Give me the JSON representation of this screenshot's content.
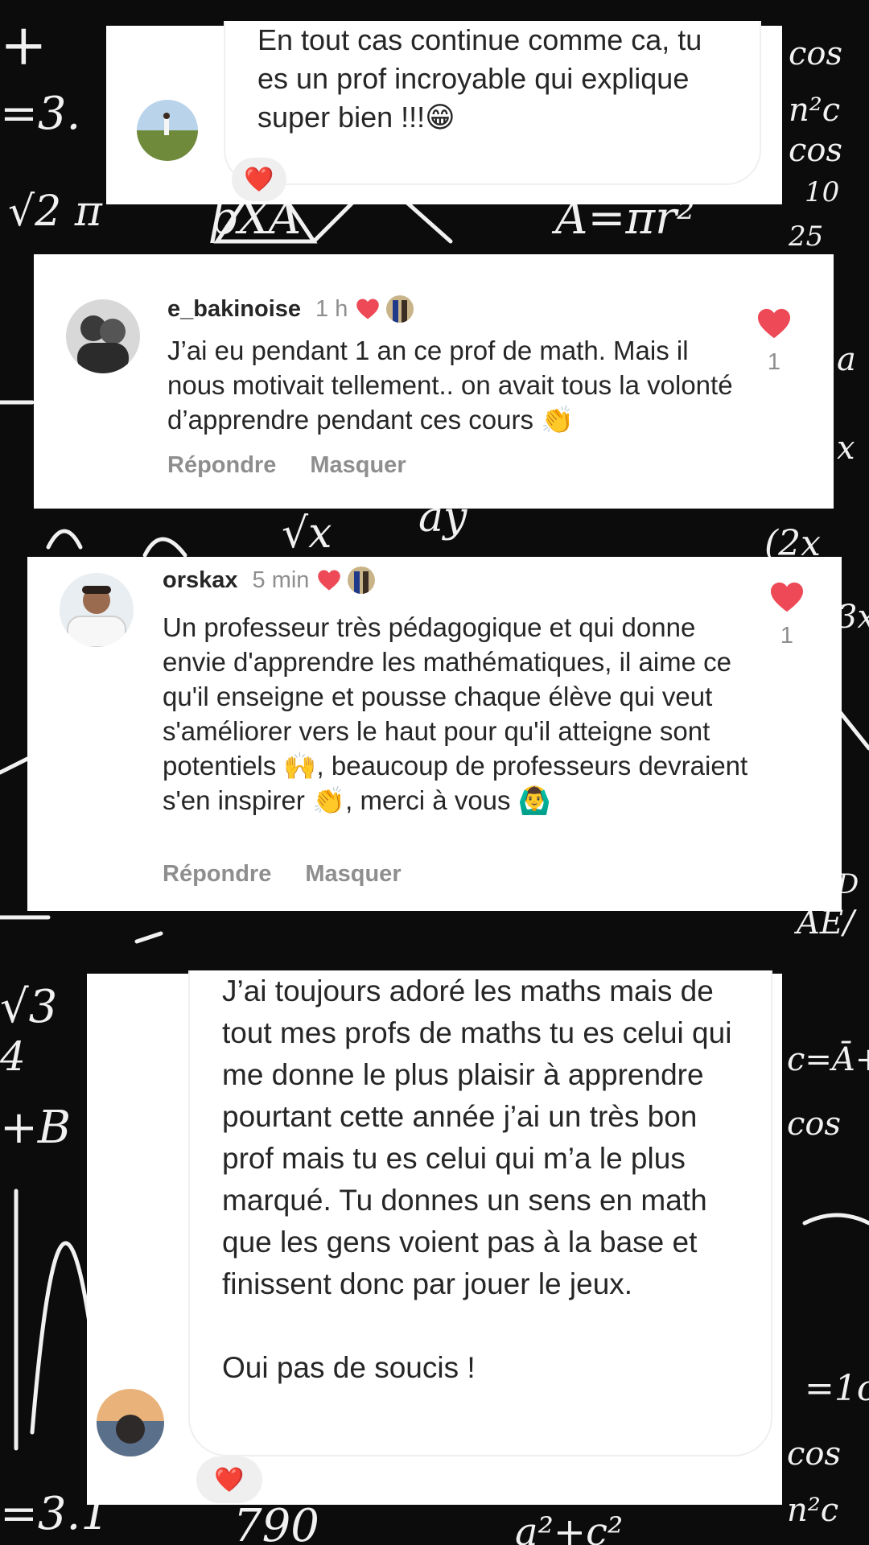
{
  "message_top": {
    "text": "En tout cas continue comme ca, tu es un prof incroyable qui explique super bien !!!😁",
    "reaction": "❤️"
  },
  "comments": [
    {
      "username": "e_bakinoise",
      "time": "1 h",
      "text": "J’ai eu pendant 1 an ce prof de math. Mais il nous motivait tellement.. on avait tous la volonté d’apprendre pendant ces cours 👏",
      "reply_label": "Répondre",
      "hide_label": "Masquer",
      "like_count": "1"
    },
    {
      "username": "orskax",
      "time": "5 min",
      "text": "Un professeur très pédagogique et qui donne envie d'apprendre les mathématiques, il aime ce qu'il enseigne et pousse chaque élève qui veut s'améliorer vers le haut pour qu'il atteigne sont potentiels 🙌, beaucoup de professeurs devraient s'en inspirer 👏, merci à vous 🙆‍♂️",
      "reply_label": "Répondre",
      "hide_label": "Masquer",
      "like_count": "1"
    }
  ],
  "message_bottom": {
    "text": "J’ai toujours adoré les maths mais de tout mes profs de maths tu es celui qui me donne le plus plaisir à apprendre pourtant cette année j’ai un très bon prof mais tu es celui qui m’a le plus marqué. Tu donnes un sens en math que les gens voient pas à la base et finissent donc par jouer le jeux.\n\nOui pas de soucis !",
    "reaction": "❤️"
  },
  "colors": {
    "heart": "#ed4956",
    "background": "#0c0c0c",
    "chalk": "#f1f1f1",
    "muted_text": "#8e8e8e"
  }
}
